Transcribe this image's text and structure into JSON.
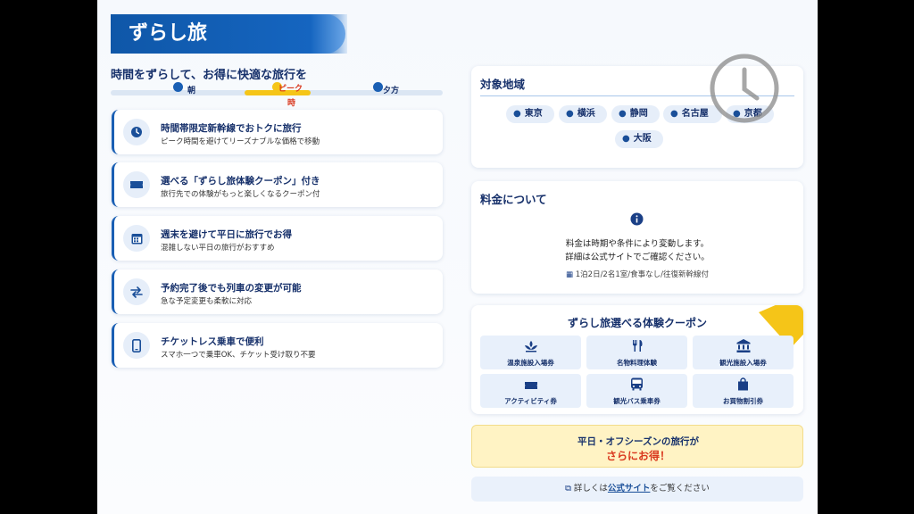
{
  "header": {
    "title": "ずらし旅"
  },
  "hero": {
    "subtitle": "時間をずらして、お得に快適な旅行を",
    "timeline": {
      "morning": "朝",
      "peak_line1": "ピーク",
      "peak_line2": "時",
      "evening": "夕方"
    }
  },
  "features": [
    {
      "icon": "clock-icon",
      "title": "時間帯限定新幹線でおトクに旅行",
      "desc": "ピーク時間を避けてリーズナブルな価格で移動"
    },
    {
      "icon": "ticket-icon",
      "title": "選べる「ずらし旅体験クーポン」付き",
      "desc": "旅行先での体験がもっと楽しくなるクーポン付"
    },
    {
      "icon": "calendar-icon",
      "title": "週末を避けて平日に旅行でお得",
      "desc": "混雑しない平日の旅行がおすすめ"
    },
    {
      "icon": "swap-icon",
      "title": "予約完了後でも列車の変更が可能",
      "desc": "急な予定変更も柔軟に対応"
    },
    {
      "icon": "smartphone-icon",
      "title": "チケットレス乗車で便利",
      "desc": "スマホ一つで乗車OK、チケット受け取り不要"
    }
  ],
  "regions": {
    "title": "対象地域",
    "items": [
      "東京",
      "横浜",
      "静岡",
      "名古屋",
      "京都",
      "大阪"
    ]
  },
  "price": {
    "title": "料金について",
    "line1": "料金は時期や条件により変動します。",
    "line2": "詳細は公式サイトでご確認ください。",
    "plan": "1泊2日/2名1室/食事なし/往復新幹線付"
  },
  "coupons": {
    "title": "ずらし旅選べる体験クーポン",
    "items": [
      {
        "icon": "spa-icon",
        "label": "温泉施設入場券"
      },
      {
        "icon": "utensils-icon",
        "label": "名物料理体験"
      },
      {
        "icon": "landmark-icon",
        "label": "観光施設入場券"
      },
      {
        "icon": "ticket-icon",
        "label": "アクティビティ券"
      },
      {
        "icon": "bus-icon",
        "label": "観光バス乗車券"
      },
      {
        "icon": "shopping-bag-icon",
        "label": "お買物割引券"
      }
    ]
  },
  "promo": {
    "line1": "平日・オフシーズンの旅行が",
    "line2": "さらにお得！"
  },
  "footer_link": {
    "prefix": "詳しくは",
    "link": "公式サイト",
    "suffix": "をご覧ください"
  },
  "colors": {
    "primary": "#1565c0",
    "navy": "#17316b",
    "accent_yellow": "#f5c518",
    "accent_red": "#d9381e"
  }
}
